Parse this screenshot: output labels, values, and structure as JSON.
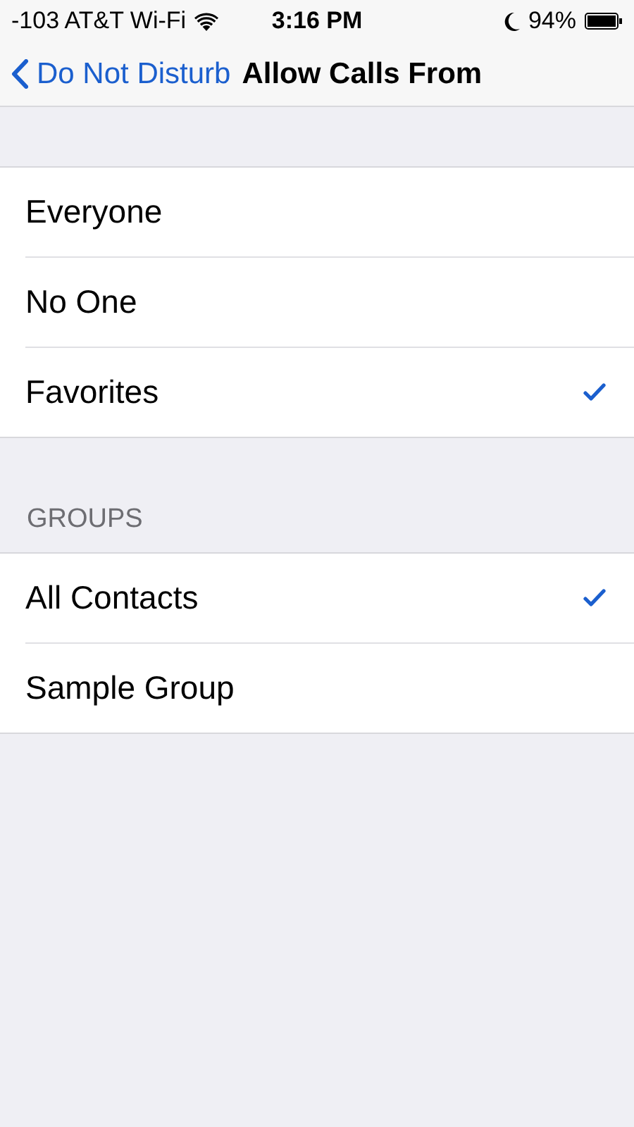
{
  "status_bar": {
    "carrier": "-103 AT&T Wi-Fi",
    "time": "3:16 PM",
    "battery": "94%"
  },
  "nav_bar": {
    "back": "Do Not Disturb",
    "title": "Allow Calls From"
  },
  "sections": [
    {
      "items": [
        {
          "label": "Everyone",
          "selected": false
        },
        {
          "label": "No One",
          "selected": false
        },
        {
          "label": "Favorites",
          "selected": true
        }
      ]
    },
    {
      "header": "GROUPS",
      "items": [
        {
          "label": "All Contacts",
          "selected": true
        },
        {
          "label": "Sample Group",
          "selected": false
        }
      ]
    }
  ]
}
